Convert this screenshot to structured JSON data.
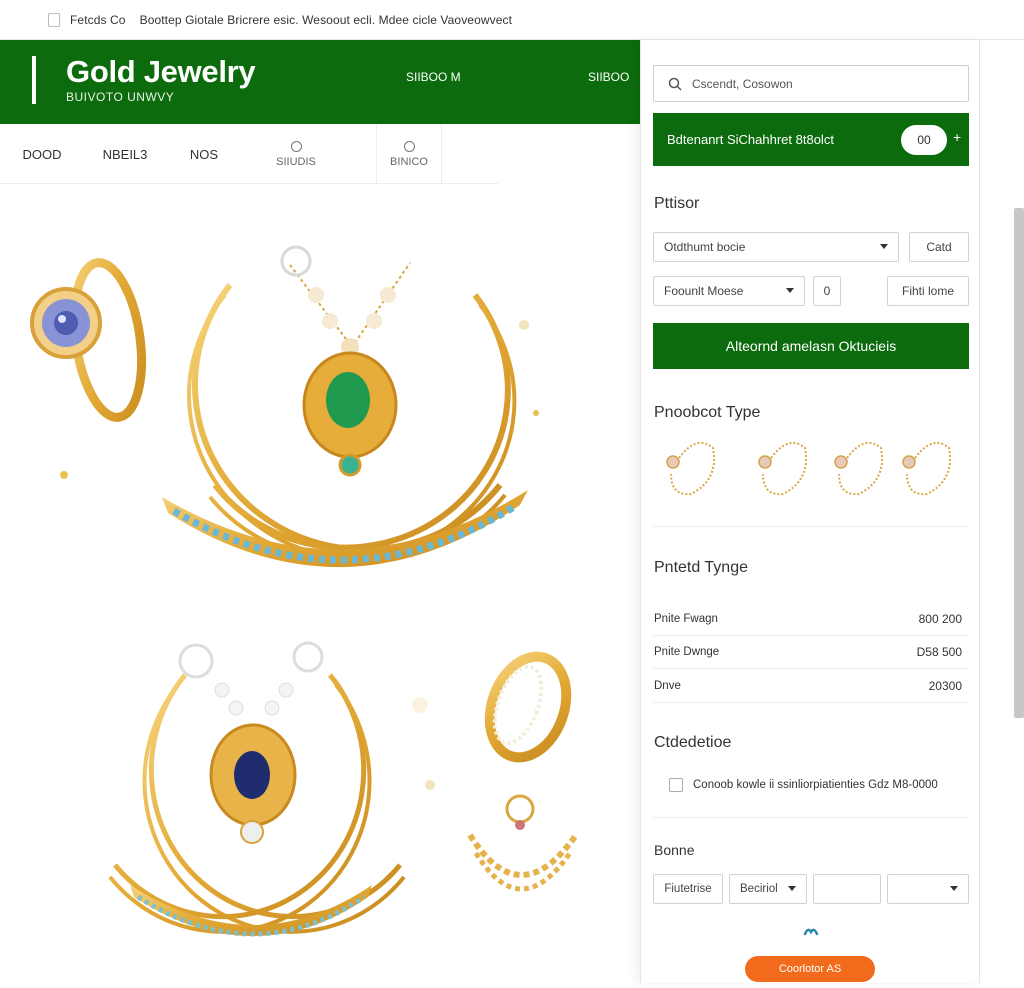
{
  "browser": {
    "tab_text": "Fetcds Co",
    "url_text": "Boottep Giotale  Bricrere esic. Wesoout ecli. Mdee cicle  Vaoveowvect"
  },
  "header": {
    "title": "Gold Jewelry",
    "subtitle": "BUIVOTO UNWVY",
    "link_1": "SIIBOO M",
    "link_2": "SIIBOO"
  },
  "nav": {
    "items": [
      {
        "label": "DOOD"
      },
      {
        "label": "NBEIL3"
      },
      {
        "label": "NOS"
      },
      {
        "label": "SIIUDIS"
      },
      {
        "label": "BINICO"
      }
    ]
  },
  "sidebar": {
    "search": {
      "value": "Cscendt, Cosowon"
    },
    "promo": {
      "text": "Bdtenanrt SiChahhret 8t8olct",
      "pill": "00",
      "plus": "+"
    },
    "filters": {
      "title": "Pttisor",
      "select_1": "Otdthumt bocie",
      "button_1": "Catd",
      "select_2": "Foounlt Moese",
      "button_2": "0",
      "button_3": "Fihti lome",
      "apply_button": "Alteornd amelasn Oktucieis"
    },
    "product_type": {
      "title": "Pnoobcot Type"
    },
    "price_range": {
      "title": "Pntetd Tynge",
      "rows": [
        {
          "label": "Pnite Fwagn",
          "value": "800 200"
        },
        {
          "label": "Pnite Dwnge",
          "value": "D58 500"
        },
        {
          "label": "Dnve",
          "value": "20300"
        }
      ]
    },
    "collection": {
      "title": "Ctdedetioe",
      "checkbox_label": "Conoob kowle ii ssinliorpiatienties Gdz M8-0000"
    },
    "bottom": {
      "title": "Bonne",
      "field_1": "Fiutetrise",
      "select_1": "Beciriol",
      "field_2": "",
      "select_2": "",
      "cta": "Coorlotor   AS"
    }
  },
  "colors": {
    "brand_green": "#0c6b0c",
    "accent_orange": "#f26a1b",
    "gold": "#e2ad34"
  }
}
